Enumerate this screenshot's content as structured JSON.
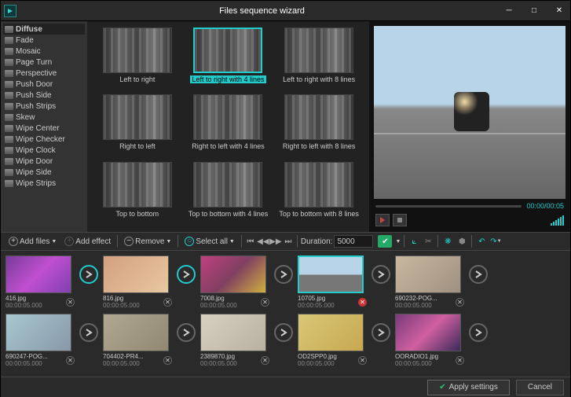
{
  "window": {
    "title": "Files sequence wizard"
  },
  "sidebar": {
    "items": [
      "Diffuse",
      "Fade",
      "Mosaic",
      "Page Turn",
      "Perspective",
      "Push Door",
      "Push Side",
      "Push Strips",
      "Skew",
      "Wipe Center",
      "Wipe Checker",
      "Wipe Clock",
      "Wipe Door",
      "Wipe Side",
      "Wipe Strips"
    ],
    "selected": 0
  },
  "transitions": [
    {
      "label": "Left to right"
    },
    {
      "label": "Left to right with 4 lines",
      "selected": true
    },
    {
      "label": "Left to right with 8 lines"
    },
    {
      "label": "Right to left"
    },
    {
      "label": "Right to left with 4 lines"
    },
    {
      "label": "Right to left with 8 lines"
    },
    {
      "label": "Top to bottom"
    },
    {
      "label": "Top to bottom with 4 lines"
    },
    {
      "label": "Top to bottom with 8 lines"
    }
  ],
  "preview": {
    "time": "00:00/00:05"
  },
  "toolbar": {
    "add_files": "Add files",
    "add_effect": "Add effect",
    "remove": "Remove",
    "select_all": "Select all",
    "duration_label": "Duration:",
    "duration_value": "5000"
  },
  "clips_row1": [
    {
      "name": "416.jpg",
      "dur": "00:00:05.000",
      "thumb": "th-purple",
      "arrow": "teal"
    },
    {
      "name": "816.jpg",
      "dur": "00:00:05.000",
      "thumb": "th-woman",
      "arrow": "teal"
    },
    {
      "name": "7008.jpg",
      "dur": "00:00:05.000",
      "thumb": "th-graf",
      "arrow": "gray"
    },
    {
      "name": "10705.jpg",
      "dur": "00:00:05.000",
      "thumb": "th-moto",
      "arrow": "gray",
      "selected": true,
      "red": true
    },
    {
      "name": "690232-POG...",
      "dur": "00:00:05.000",
      "thumb": "th-ppl1",
      "arrow": "gray"
    }
  ],
  "clips_row2": [
    {
      "name": "690247-POG...",
      "dur": "00:00:05.000",
      "thumb": "th-ppl2",
      "arrow": "gray"
    },
    {
      "name": "704402-PR4...",
      "dur": "00:00:05.000",
      "thumb": "th-ppl3",
      "arrow": "gray"
    },
    {
      "name": "2389870.jpg",
      "dur": "00:00:05.000",
      "thumb": "th-grp",
      "arrow": "gray"
    },
    {
      "name": "OD2SPP0.jpg",
      "dur": "00:00:05.000",
      "thumb": "th-yel",
      "arrow": "gray"
    },
    {
      "name": "OORADIO1.jpg",
      "dur": "00:00:05.000",
      "thumb": "th-conc",
      "arrow": "gray"
    }
  ],
  "footer": {
    "apply": "Apply settings",
    "cancel": "Cancel"
  }
}
